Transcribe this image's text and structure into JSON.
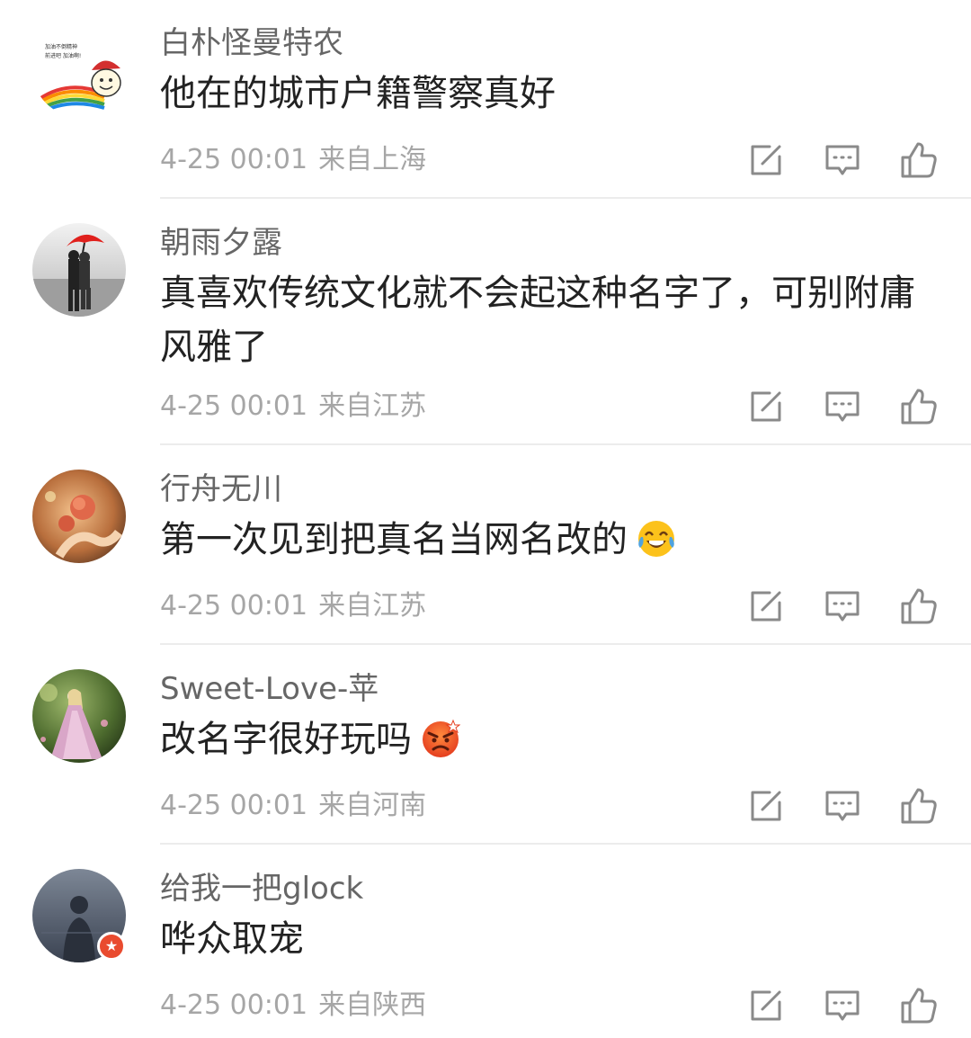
{
  "comments": [
    {
      "username": "白朴怪曼特农",
      "text": "他在的城市户籍警察真好",
      "time": "4-25 00:01",
      "location": "来自上海",
      "avatar_icon": "cartoon-rainbow-avatar",
      "avatar_text": [
        "加油不倒精神",
        "前进吧 加油啊!"
      ]
    },
    {
      "username": "朝雨夕露",
      "text": "真喜欢传统文化就不会起这种名字了，可别附庸风雅了",
      "time": "4-25 00:01",
      "location": "来自江苏",
      "avatar_icon": "couple-red-umbrella-avatar"
    },
    {
      "username": "行舟无川",
      "text": "第一次见到把真名当网名改的",
      "emoji": "laugh-cry-emoji",
      "time": "4-25 00:01",
      "location": "来自江苏",
      "avatar_icon": "flower-hand-avatar"
    },
    {
      "username": "Sweet-Love-苹",
      "text": "改名字很好玩吗",
      "emoji": "angry-emoji",
      "time": "4-25 00:01",
      "location": "来自河南",
      "avatar_icon": "fairy-pink-dress-avatar"
    },
    {
      "username": "给我一把glock",
      "text": "哗众取宠",
      "time": "4-25 00:01",
      "location": "来自陕西",
      "avatar_icon": "dark-figure-avatar",
      "badge_icon": "verified-star-badge"
    }
  ],
  "actions": [
    "share-icon",
    "comment-icon",
    "like-icon"
  ],
  "colors": {
    "username": "#666666",
    "content": "#222222",
    "meta": "#a6a6a6",
    "icon": "#8a8a8a",
    "divider": "#ececec",
    "badge": "#e94b2f"
  }
}
